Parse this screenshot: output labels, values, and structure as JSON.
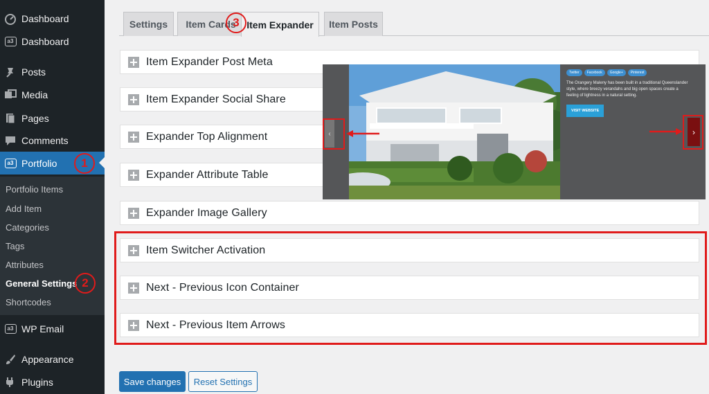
{
  "sidebar": {
    "items": [
      {
        "label": "Dashboard",
        "icon": "dashboard-icon"
      },
      {
        "label": "Dashboard",
        "icon": "a3-icon"
      },
      {
        "label": "Posts",
        "icon": "pin-icon"
      },
      {
        "label": "Media",
        "icon": "media-icon"
      },
      {
        "label": "Pages",
        "icon": "pages-icon"
      },
      {
        "label": "Comments",
        "icon": "comments-icon"
      },
      {
        "label": "Portfolio",
        "icon": "a3-icon"
      },
      {
        "label": "WP Email",
        "icon": "a3-icon"
      },
      {
        "label": "Appearance",
        "icon": "brush-icon"
      },
      {
        "label": "Plugins",
        "icon": "plug-icon"
      }
    ],
    "submenu": [
      "Portfolio Items",
      "Add Item",
      "Categories",
      "Tags",
      "Attributes",
      "General Settings",
      "Shortcodes"
    ],
    "a3_glyph": "a3"
  },
  "badges": {
    "one": "1",
    "two": "2",
    "three": "3"
  },
  "tabs": [
    "Settings",
    "Item Cards",
    "Item Expander",
    "Item Posts"
  ],
  "panels": [
    "Item Expander Post Meta",
    "Item Expander Social Share",
    "Expander Top Alignment",
    "Expander Attribute Table",
    "Expander Image Gallery",
    "Item Switcher Activation",
    "Next - Previous Icon Container",
    "Next - Previous Item Arrows"
  ],
  "preview": {
    "share_buttons": [
      "Twitter",
      "Facebook",
      "Google+",
      "Pinterest"
    ],
    "description": "The Orangery Maleny has been built in a traditional Queenslander style, where breezy verandahs and big open spaces create a feeling of lightness in a natural setting.",
    "visit_label": "VISIT WEBSITE",
    "prev_glyph": "‹",
    "next_glyph": "›"
  },
  "buttons": {
    "save": "Save changes",
    "reset": "Reset Settings"
  },
  "colors": {
    "accent": "#2271b1",
    "annotation_red": "#e01b1b",
    "sidebar_bg": "#1d2327"
  }
}
